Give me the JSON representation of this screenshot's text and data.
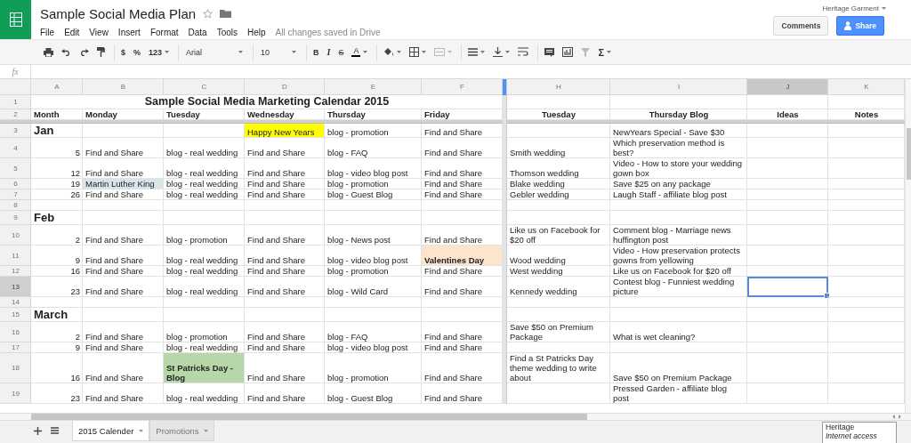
{
  "document": {
    "title": "Sample Social Media Plan",
    "starred": false
  },
  "menu": [
    "File",
    "Edit",
    "View",
    "Insert",
    "Format",
    "Data",
    "Tools",
    "Help"
  ],
  "save_status": "All changes saved in Drive",
  "account": "Heritage Garment",
  "buttons": [
    {
      "label": "Comments",
      "kind": "plain"
    },
    {
      "label": "Share",
      "kind": "primary"
    }
  ],
  "toolbar": {
    "currency": "$",
    "percent": "%",
    "number_format": "123",
    "font": "Arial",
    "font_size": "10",
    "bold": "B",
    "italic": "I",
    "strikethrough": "S",
    "text_color": "A",
    "functions": "Σ"
  },
  "formula_bar": {
    "label": "fx"
  },
  "columns": [
    {
      "label": "A",
      "selected": false
    },
    {
      "label": "B",
      "selected": false
    },
    {
      "label": "C",
      "selected": false
    },
    {
      "label": "D",
      "selected": false
    },
    {
      "label": "E",
      "selected": false
    },
    {
      "label": "F",
      "selected": false
    },
    {
      "label": "H",
      "selected": false
    },
    {
      "label": "I",
      "selected": false
    },
    {
      "label": "J",
      "selected": true
    },
    {
      "label": "K",
      "selected": false
    }
  ],
  "rows": [
    {
      "number": "1",
      "selected": false,
      "kind": "title",
      "title": "Sample Social Media Marketing Calendar 2015"
    },
    {
      "number": "2",
      "selected": false,
      "kind": "header",
      "cells": [
        "Month",
        "Monday",
        "Tuesday",
        "Wednesday",
        "Thursday",
        "Friday",
        "Tuesday",
        "Thursday Blog",
        "Ideas",
        "Notes"
      ]
    },
    {
      "number": "3",
      "selected": false,
      "kind": "data",
      "cells": [
        {
          "text": "Jan",
          "kind": "month"
        },
        null,
        null,
        {
          "text": "Happy New Years",
          "kind": "note",
          "color": "#ffff00",
          "bold": false
        },
        "blog - promotion",
        "Find and Share",
        null,
        "NewYears Special - Save $30",
        null,
        null
      ]
    },
    {
      "number": "4",
      "selected": false,
      "kind": "data",
      "cells": [
        "5",
        "Find and Share",
        "blog - real wedding",
        "Find and Share",
        "blog - FAQ",
        "Find and Share",
        "Smith wedding",
        "Which preservation method is best?",
        null,
        null
      ]
    },
    {
      "number": "5",
      "selected": false,
      "kind": "data",
      "cells": [
        "12",
        "Find and Share",
        "blog - real wedding",
        "Find and Share",
        "blog - video blog post",
        "Find and Share",
        "Thomson wedding",
        "Video - How to store your wedding gown box",
        null,
        null
      ]
    },
    {
      "number": "6",
      "selected": false,
      "kind": "data",
      "cells": [
        "19",
        {
          "text": "Martin Luther King",
          "kind": "note",
          "color": "#d9e4ea",
          "bold": false
        },
        "blog - real wedding",
        "Find and Share",
        "blog - promotion",
        "Find and Share",
        "Blake wedding",
        "Save $25 on any package",
        null,
        null
      ]
    },
    {
      "number": "7",
      "selected": false,
      "kind": "data",
      "cells": [
        "26",
        "Find and Share",
        "blog - real wedding",
        "Find and Share",
        "blog - Guest Blog",
        "Find and Share",
        "Gebler wedding",
        "Laugh Staff - affiliate blog post",
        null,
        null
      ]
    },
    {
      "number": "8",
      "selected": false,
      "kind": "data",
      "cells": [
        null,
        null,
        null,
        null,
        null,
        null,
        null,
        null,
        null,
        null
      ]
    },
    {
      "number": "9",
      "selected": false,
      "kind": "data",
      "cells": [
        {
          "text": "Feb",
          "kind": "month"
        },
        null,
        null,
        null,
        null,
        null,
        null,
        null,
        null,
        null
      ]
    },
    {
      "number": "10",
      "selected": false,
      "kind": "data",
      "cells": [
        "2",
        "Find and Share",
        "blog - promotion",
        "Find and Share",
        "blog - News post",
        "Find and Share",
        "Like us on Facebook for $20 off",
        "Comment blog - Marriage news huffington post",
        null,
        null
      ]
    },
    {
      "number": "11",
      "selected": false,
      "kind": "data",
      "cells": [
        "9",
        "Find and Share",
        "blog - real wedding",
        "Find and Share",
        "blog - video blog post",
        {
          "text": "Valentines Day",
          "kind": "note",
          "color": "#fce5cd",
          "bold": true
        },
        "Wood wedding",
        "Video - How preservation protects gowns from yellowing",
        null,
        null
      ]
    },
    {
      "number": "12",
      "selected": false,
      "kind": "data",
      "cells": [
        "16",
        "Find and Share",
        "blog - real wedding",
        "Find and Share",
        "blog - promotion",
        "Find and Share",
        "West wedding",
        "Like us on Facebook for $20 off",
        null,
        null
      ]
    },
    {
      "number": "13",
      "selected": true,
      "kind": "data",
      "cells": [
        "23",
        "Find and Share",
        "blog - real wedding",
        "Find and Share",
        "blog - Wild Card",
        "Find and Share",
        "Kennedy wedding",
        "Contest blog - Funniest wedding picture",
        null,
        null
      ]
    },
    {
      "number": "14",
      "selected": false,
      "kind": "data",
      "cells": [
        null,
        null,
        null,
        null,
        null,
        null,
        null,
        null,
        null,
        null
      ]
    },
    {
      "number": "15",
      "selected": false,
      "kind": "data",
      "cells": [
        {
          "text": "March",
          "kind": "month"
        },
        null,
        null,
        null,
        null,
        null,
        null,
        null,
        null,
        null
      ]
    },
    {
      "number": "16",
      "selected": false,
      "kind": "data",
      "cells": [
        "2",
        "Find and Share",
        "blog - promotion",
        "Find and Share",
        "blog - FAQ",
        "Find and Share",
        "Save $50 on Premium Package",
        "What is wet cleaning?",
        null,
        null
      ]
    },
    {
      "number": "17",
      "selected": false,
      "kind": "data",
      "cells": [
        "9",
        "Find and Share",
        "blog - real wedding",
        "Find and Share",
        "blog - video blog post",
        "Find and Share",
        null,
        null,
        null,
        null
      ]
    },
    {
      "number": "18",
      "selected": false,
      "kind": "data",
      "cells": [
        "16",
        "Find and Share",
        {
          "text": "St Patricks Day - Blog",
          "kind": "note",
          "color": "#b6d7a8",
          "bold": true
        },
        "Find and Share",
        "blog - promotion",
        "Find and Share",
        "Find a St Patricks Day theme wedding to write about",
        "Save $50 on Premium Package",
        null,
        null
      ]
    },
    {
      "number": "19",
      "selected": false,
      "kind": "data",
      "cells": [
        "23",
        "Find and Share",
        "blog - real wedding",
        "Find and Share",
        "blog - Guest Blog",
        "Find and Share",
        null,
        "Pressed Garden - affiliate blog post",
        null,
        null
      ]
    }
  ],
  "sheet_tabs": [
    {
      "label": "2015 Calender",
      "selected": true
    },
    {
      "label": "Promotions",
      "selected": false
    }
  ],
  "tooltip": {
    "title": "Heritage",
    "subtitle": "Internet access"
  }
}
